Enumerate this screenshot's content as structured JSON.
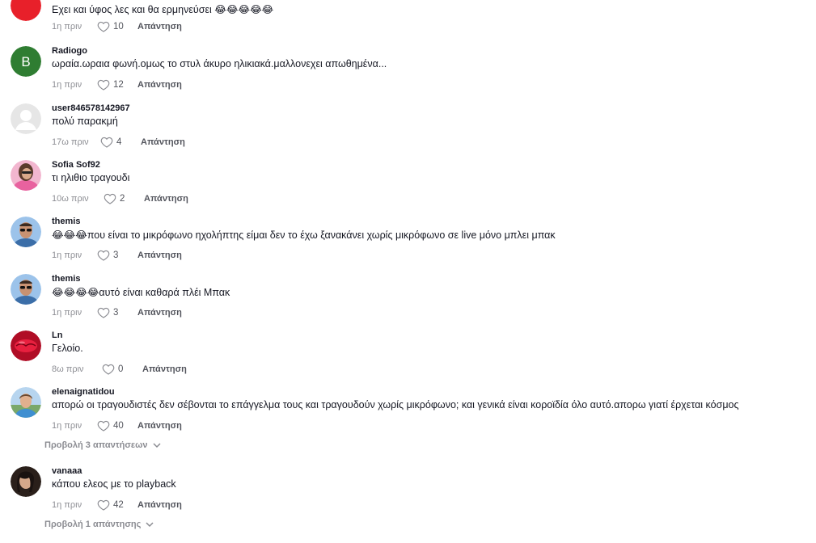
{
  "reply_label": "Απάντηση",
  "comments": [
    {
      "username": "",
      "text": "Εχει και ύφος λες και θα ερμηνεύσει 😂😂😂😂😂",
      "time": "1η πριν",
      "likes": "10",
      "avatar_icon": "red-circle-avatar",
      "avatar_color": "#e8202a"
    },
    {
      "username": "Radiogo",
      "text": "ωραία.ωραια φωνή.ομως το στυλ άκυρο ηλικιακά.μαλλονεχει απωθημένα...",
      "time": "1η πριν",
      "likes": "12",
      "avatar_icon": "letter-avatar",
      "avatar_letter": "B",
      "avatar_color": "#2f7d32"
    },
    {
      "username": "user846578142967",
      "text": "πολύ παρακμή",
      "time": "17ω πριν",
      "likes": "4",
      "avatar_icon": "default-user-avatar",
      "avatar_color": "#e6e6e6"
    },
    {
      "username": "Sofia Sof92",
      "text": "τι ηλιθιο τραγουδι",
      "time": "10ω πριν",
      "likes": "2",
      "avatar_icon": "photo-avatar-woman-pink",
      "avatar_color": "#e87ab0"
    },
    {
      "username": "themis",
      "text": "😂😂😂που είναι το μικρόφωνο ηχολήπτης είμαι δεν το έχω ξανακάνει χωρίς μικρόφωνο σε live μόνο μπλει μπακ",
      "time": "1η πριν",
      "likes": "3",
      "avatar_icon": "photo-avatar-man-sunglasses",
      "avatar_color": "#6fa3d6"
    },
    {
      "username": "themis",
      "text": "😂😂😂😂αυτό είναι καθαρά πλέι Μπακ",
      "time": "1η πριν",
      "likes": "3",
      "avatar_icon": "photo-avatar-man-sunglasses",
      "avatar_color": "#6fa3d6"
    },
    {
      "username": "Ln",
      "text": "Γελοίο.",
      "time": "8ω πριν",
      "likes": "0",
      "avatar_icon": "photo-avatar-red-lips",
      "avatar_color": "#c8102e"
    },
    {
      "username": "elenaignatidou",
      "text": "απορώ οι τραγουδιστές δεν σέβονται το επάγγελμα τους και τραγουδούν χωρίς μικρόφωνο; και γενικά είναι κοροϊδία όλο αυτό.απορω γιατί έρχεται κόσμος",
      "time": "1η πριν",
      "likes": "40",
      "avatar_icon": "photo-avatar-woman-outdoor",
      "avatar_color": "#5b9bd5",
      "view_replies": "Προβολή 3 απαντήσεων"
    },
    {
      "username": "vanaaa",
      "text": "κάπου ελεος με το playback",
      "time": "1η πριν",
      "likes": "42",
      "avatar_icon": "photo-avatar-woman-dark",
      "avatar_color": "#3a2a22",
      "view_replies": "Προβολή 1 απάντησης"
    }
  ]
}
